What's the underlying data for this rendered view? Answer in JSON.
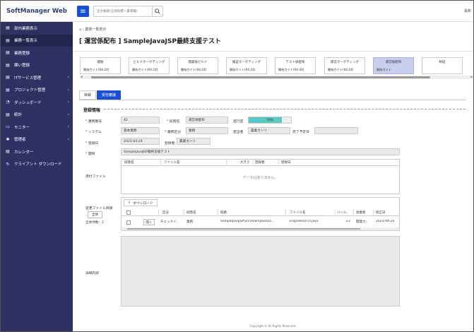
{
  "app": {
    "brand": "SoftManager Web",
    "topright": "最新"
  },
  "search": {
    "placeholder": "全文検索(全体指標＋最適検)"
  },
  "sidebar": {
    "items": [
      {
        "icon": "▤",
        "label": "部内業務表示",
        "chev": ""
      },
      {
        "icon": "▤",
        "label": "業務一覧表示",
        "chev": ""
      },
      {
        "icon": "▤",
        "label": "業務登録",
        "chev": ""
      },
      {
        "icon": "▤",
        "label": "課い登録",
        "chev": ""
      },
      {
        "icon": "▤",
        "label": "ITサービス管理",
        "chev": "‹"
      },
      {
        "icon": "▤",
        "label": "プロジェクト管理",
        "chev": "‹"
      },
      {
        "icon": "◔",
        "label": "ダッシュボード",
        "chev": "‹"
      },
      {
        "icon": "▤",
        "label": "統計",
        "chev": "‹"
      },
      {
        "icon": "▭",
        "label": "モニター",
        "chev": "‹"
      },
      {
        "icon": "✱",
        "label": "管理者",
        "chev": "‹"
      },
      {
        "icon": "▤",
        "label": "カレンダー",
        "chev": ""
      },
      {
        "icon": "↻",
        "label": "クライアント ダウンロード",
        "chev": ""
      }
    ],
    "active_index": 1
  },
  "breadcrumb": {
    "icon": "⌂",
    "text": "業務一覧表示"
  },
  "page_title": "[ 運営係配布 ] SampleJavaJSP最終支援テスト",
  "steps": [
    {
      "name": "開始",
      "sub": "開始カイト(04-24)"
    },
    {
      "name": "ビルドターゲティング",
      "sub": "開始カイト(04-24)"
    },
    {
      "name": "開発係ビルド",
      "sub": "開始カイト(04-24)"
    },
    {
      "name": "検証ターゲティング",
      "sub": "開始カイト(04-24)"
    },
    {
      "name": "テスト係配布",
      "sub": "開始カイト(04-24)"
    },
    {
      "name": "運営ターゲティング",
      "sub": "開始カイト(04-24)"
    },
    {
      "name": "運営係配布",
      "sub": "開始カイト"
    },
    {
      "name": "終結",
      "sub": ""
    }
  ],
  "tabs": [
    {
      "label": "目録"
    },
    {
      "label": "受信審議"
    }
  ],
  "section_title": "登録情報",
  "form": {
    "task_no_label": "業務番号",
    "task_no": "42",
    "stage_label": "段階名",
    "stage": "運営係配布",
    "progress_label": "進行度",
    "progress": 78,
    "progress_text": "78%",
    "system_label": "システム",
    "system": "基本業務",
    "category_label": "業務区分",
    "category": "業務",
    "owner_label": "担当者",
    "owner": "農業カンリ",
    "due_label": "完了予定日",
    "due": "",
    "reg_date_label": "登録日",
    "reg_date": "2023-04-24",
    "registrant_label": "登録者:",
    "registrant": "農業カンリ",
    "title_label": "題目",
    "title": "SampleJavaJSP最終支援テスト"
  },
  "attach": {
    "label": "添付ファイル",
    "headers": [
      "段階名",
      "ファイル名",
      "大きさ",
      "登録者",
      "登録日"
    ],
    "empty": "データはありません。"
  },
  "changes": {
    "label": "変更ファイル目録",
    "download": "ダウンロード",
    "all_button": "全体",
    "count": "全体件数：2",
    "headers": [
      "区分",
      "段階名",
      "経路",
      "ファイル名",
      "バージ..",
      "会業者",
      "修正日"
    ],
    "rows": [
      {
        "open": "開く",
        "kind": "チェックイ..",
        "stage": "業務",
        "path": "SampleJavaJSP\\src\\main\\java\\co...",
        "file": "EngineerDTO.java",
        "ver": "13",
        "user": "開発力...",
        "date": "2023-04-24"
      }
    ]
  },
  "detail_label": "詳細内訳",
  "footer": "Copyright © All Rights Reserved."
}
